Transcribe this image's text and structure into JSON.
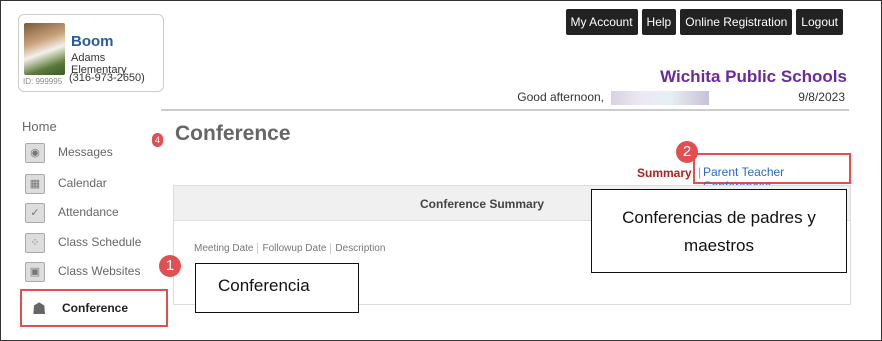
{
  "student": {
    "name": "Boom",
    "school": "Adams Elementary",
    "id_text": "ID: 999995",
    "phone": "(316-973-2650)"
  },
  "topnav": [
    "My Account",
    "Help",
    "Online Registration",
    "Logout"
  ],
  "district": "Wichita Public Schools",
  "greeting": "Good afternoon,",
  "date": "9/8/2023",
  "sidebar": {
    "home": "Home",
    "items": [
      {
        "label": "Messages",
        "icon": "message-icon",
        "badge": "4"
      },
      {
        "label": "Calendar",
        "icon": "calendar-icon"
      },
      {
        "label": "Attendance",
        "icon": "checkbox-icon"
      },
      {
        "label": "Class Schedule",
        "icon": "schedule-icon"
      },
      {
        "label": "Class Websites",
        "icon": "website-icon"
      }
    ],
    "active": {
      "label": "Conference",
      "icon": "people-icon"
    }
  },
  "page": {
    "title": "Conference",
    "tab_summary": "Summary",
    "tab_sep": "|",
    "tab_ptc": "Parent Teacher Conferences"
  },
  "panel": {
    "title": "Conference Summary",
    "columns": [
      "Meeting Date",
      "Followup Date",
      "Description"
    ]
  },
  "callouts": {
    "one_num": "1",
    "one_text": "Conferencia",
    "two_num": "2",
    "two_text": "Conferencias de padres y maestros"
  },
  "colors": {
    "accent_red": "#e05050",
    "district_purple": "#6b2a9a",
    "link_blue": "#2a6ac0"
  }
}
